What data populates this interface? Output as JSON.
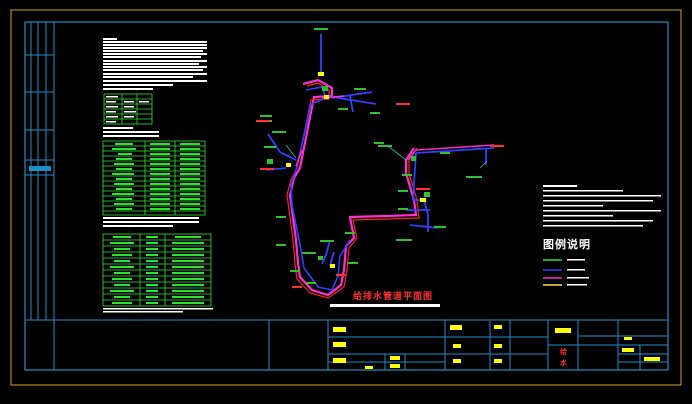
{
  "drawing": {
    "main_title": "给排水管道平面图",
    "legend_title": "图例说明",
    "titleblock_mark_1": "给",
    "titleblock_mark_2": "水"
  },
  "colors": {
    "background": "#000000",
    "frame": "#1e8fc8",
    "outer_border": "#d8a020",
    "pipe_magenta": "#ff30d0",
    "pipe_blue": "#3040ff",
    "pipe_red": "#ff2020",
    "pipe_yellow": "#ffff00",
    "table_green": "#30e030",
    "annotation_green": "#30c030",
    "label_red": "#ff3030",
    "text_white": "#ffffff"
  }
}
